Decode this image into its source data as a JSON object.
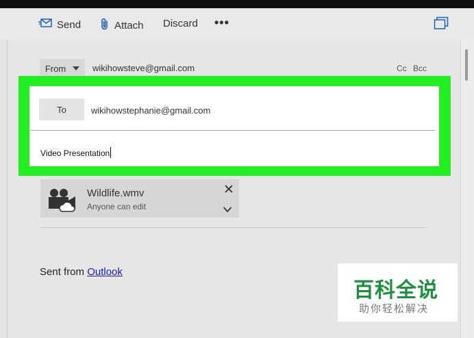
{
  "toolbar": {
    "send_label": "Send",
    "attach_label": "Attach",
    "discard_label": "Discard",
    "more_label": "•••",
    "icons": [
      "send-icon",
      "paperclip-icon",
      "popout-icon"
    ]
  },
  "header": {
    "from_label": "From",
    "from_address": "wikihowsteve@gmail.com",
    "cc_label": "Cc",
    "bcc_label": "Bcc"
  },
  "recipients": {
    "to_label": "To",
    "to_address": "wikihowstephanie@gmail.com"
  },
  "subject": {
    "value": "Video Presentation"
  },
  "attachment": {
    "file_name": "Wildlife.wmv",
    "permission": "Anyone can edit",
    "close_symbol": "✕",
    "icon": "video-camera-icon"
  },
  "body": {
    "signature_prefix": "Sent from ",
    "signature_link": "Outlook"
  },
  "watermark": {
    "main": "百科全说",
    "sub": "助你轻松解决"
  },
  "colors": {
    "highlight": "#22ee22",
    "link": "#1a1aa6",
    "watermark_green": "#1e8f3e"
  }
}
